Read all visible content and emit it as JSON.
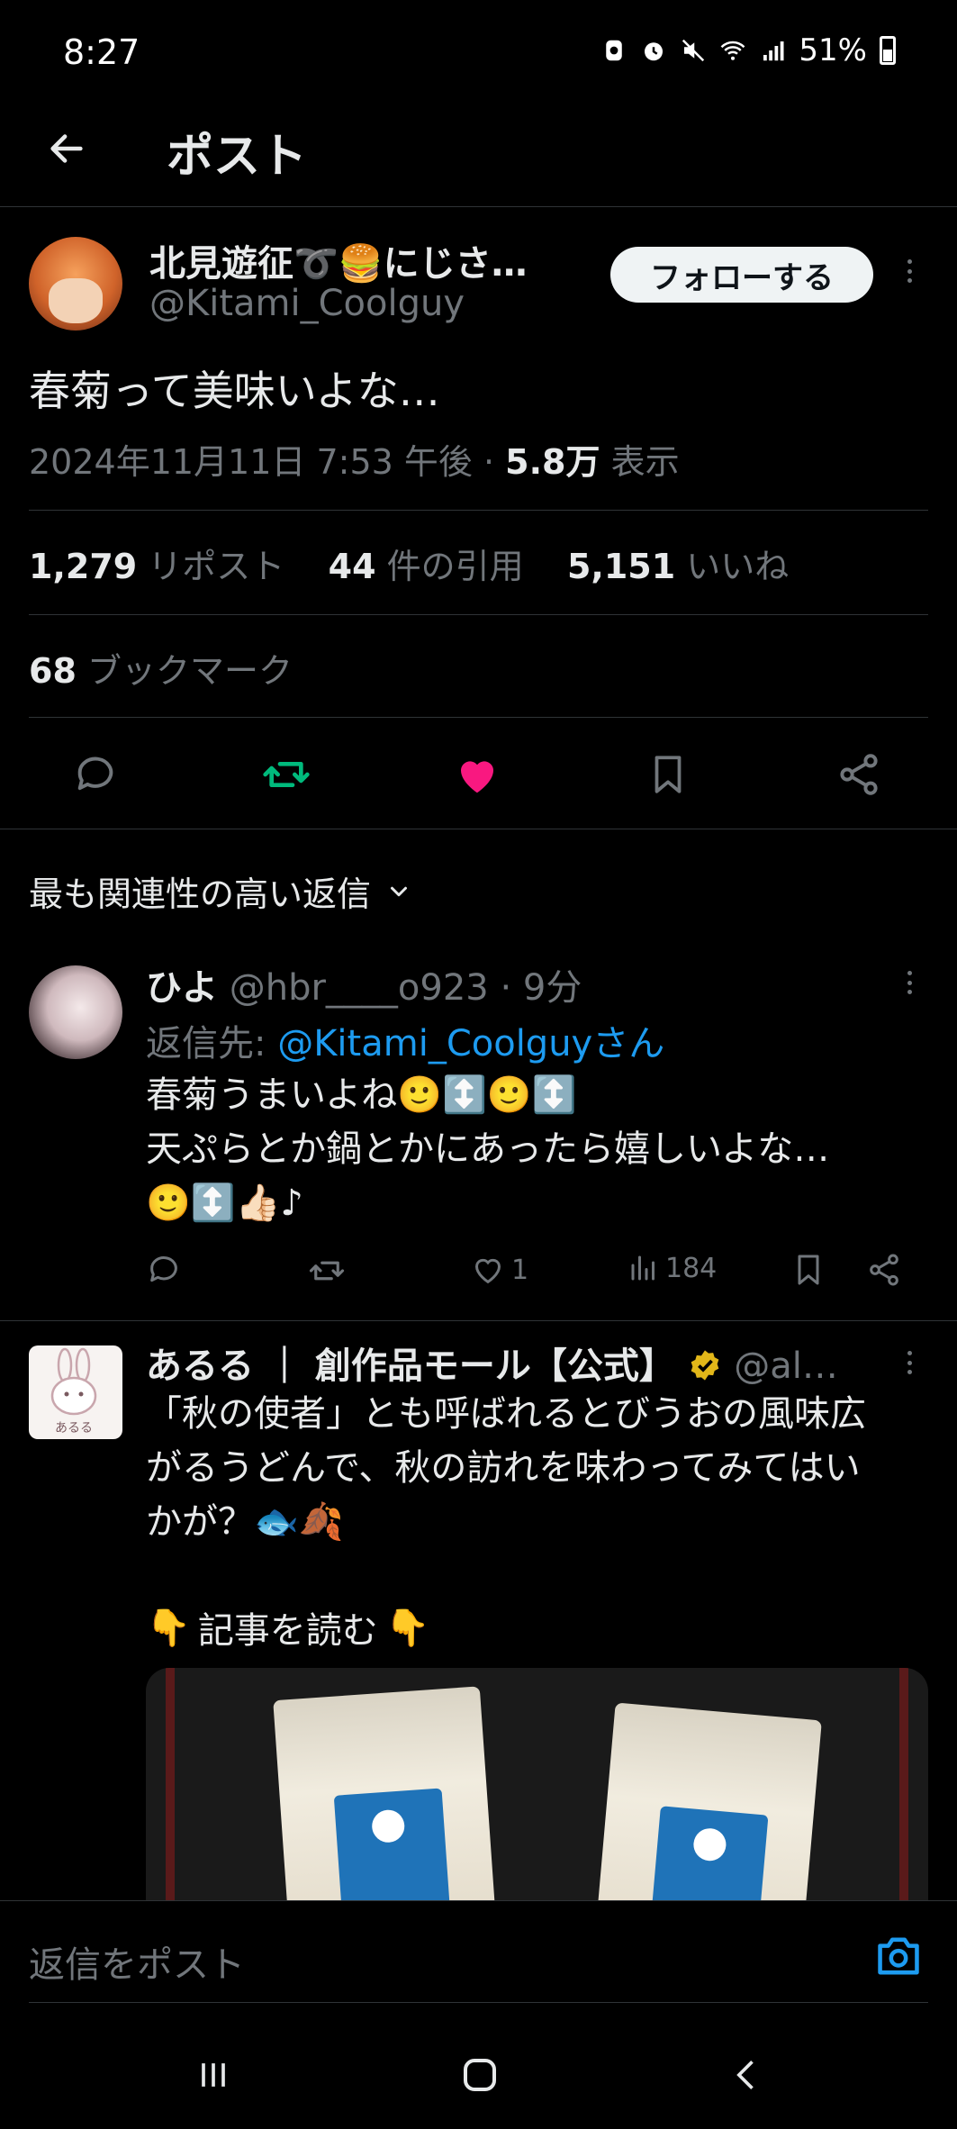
{
  "status_bar": {
    "time": "8:27",
    "battery": "51%"
  },
  "header": {
    "title": "ポスト"
  },
  "tweet": {
    "author_name": "北見遊征➰🍔にじさ…",
    "author_handle": "@Kitami_Coolguy",
    "follow_label": "フォローする",
    "text": "春菊って美味いよな…",
    "date": "2024年11月11日 7:53 午後 · ",
    "views_count": "5.8万",
    "views_label": " 表示",
    "reposts_count": "1,279",
    "reposts_label": " リポスト",
    "quotes_count": "44",
    "quotes_label": " 件の引用",
    "likes_count": "5,151",
    "likes_label": " いいね",
    "bookmarks_count": "68",
    "bookmarks_label": " ブックマーク"
  },
  "sort": {
    "label": "最も関連性の高い返信"
  },
  "reply": {
    "name": "ひよ",
    "handle_time": " @hbr____o923 · 9分",
    "reply_to_prefix": "返信先: ",
    "reply_to_handle": "@Kitami_Coolguyさん",
    "line1": "春菊うまいよね🙂↕️🙂↕️",
    "line2": "天ぷらとか鍋とかにあったら嬉しいよな…",
    "line3": "🙂↕️👍🏻♪",
    "like_count": "1",
    "view_count": "184"
  },
  "ad": {
    "name": "あるる ｜ 創作品モール【公式】",
    "handle": " @al…",
    "line1": "「秋の使者」とも呼ばれるとびうおの風味広",
    "line2": "がるうどんで、秋の訪れを味わってみてはい",
    "line3": "かが？🐟🍂",
    "cta": "記事を読む",
    "cta_emoji": "👇",
    "avatar_text": "あるる"
  },
  "composer": {
    "placeholder": "返信をポスト"
  },
  "colors": {
    "accent": "#1d9bf0",
    "like": "#f91880",
    "repost": "#00ba7c",
    "verified": "#e2b719"
  },
  "icons": [
    "back-arrow-icon",
    "more-icon",
    "reply-icon",
    "repost-icon",
    "heart-icon",
    "bookmark-icon",
    "share-icon",
    "chevron-down-icon",
    "camera-icon"
  ]
}
